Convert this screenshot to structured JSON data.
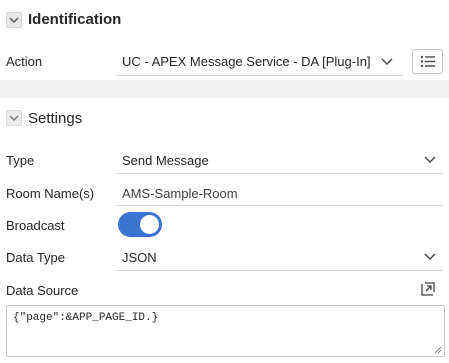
{
  "identification": {
    "title": "Identification",
    "action_label": "Action",
    "action_value": "UC - APEX Message Service - DA [Plug-In]"
  },
  "settings": {
    "title": "Settings",
    "type_label": "Type",
    "type_value": "Send Message",
    "room_label": "Room Name(s)",
    "room_value": "AMS-Sample-Room",
    "broadcast_label": "Broadcast",
    "broadcast_on": true,
    "data_type_label": "Data Type",
    "data_type_value": "JSON",
    "data_source_label": "Data Source",
    "data_source_value": "{\"page\":&APP_PAGE_ID.}"
  },
  "colors": {
    "accent": "#3a74d1"
  }
}
